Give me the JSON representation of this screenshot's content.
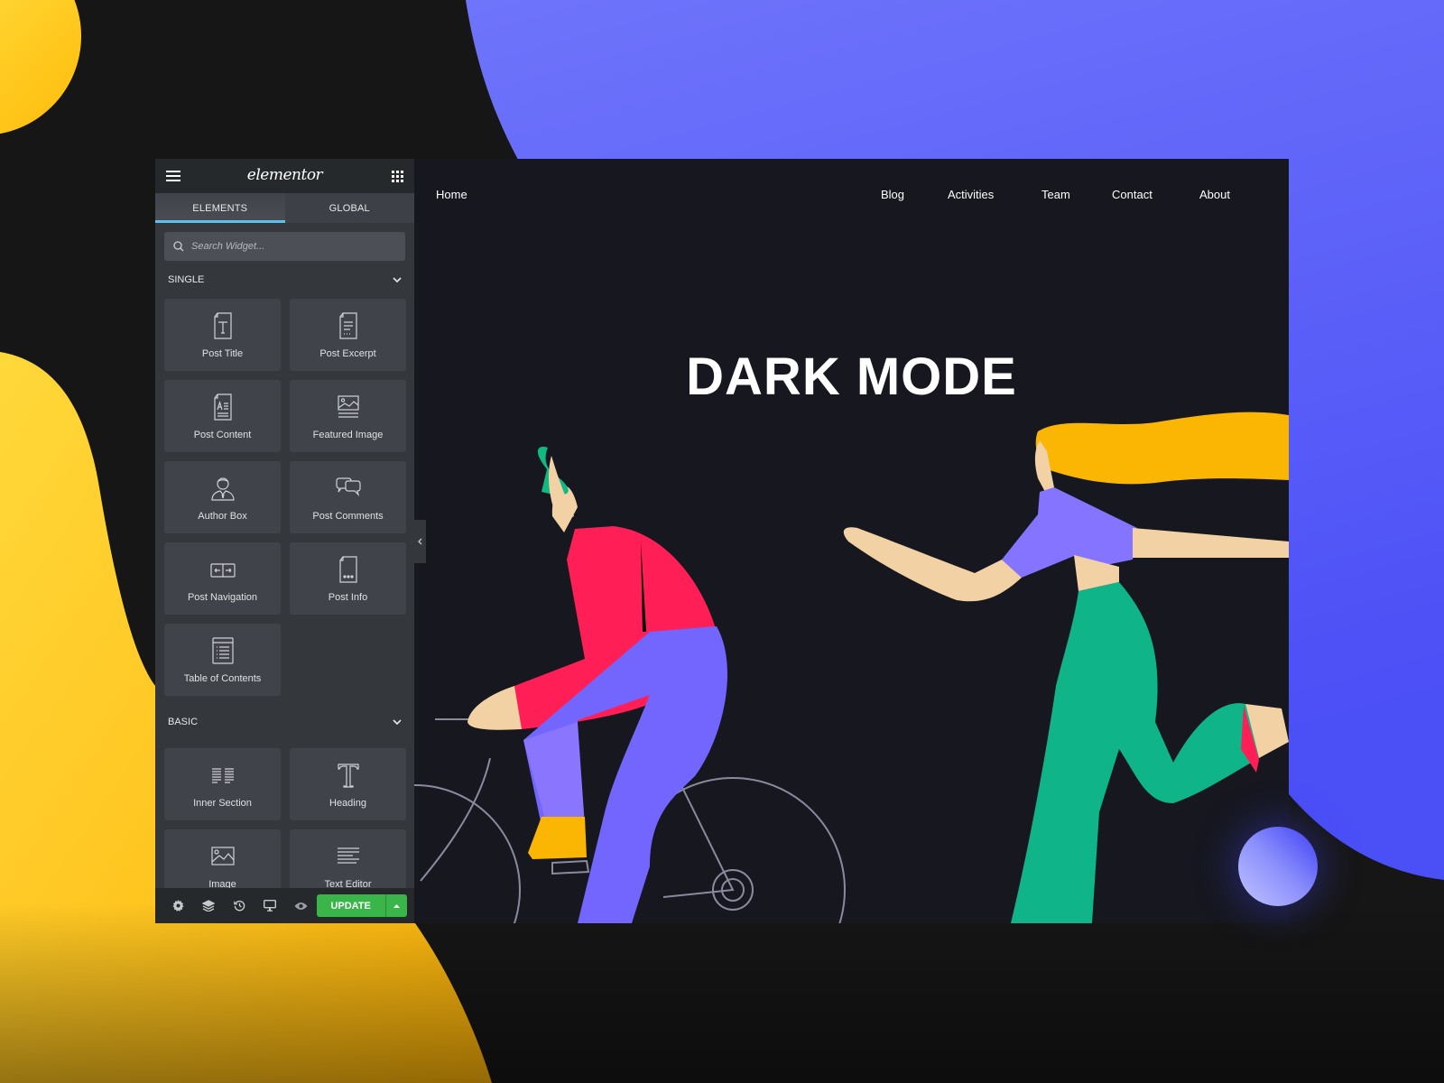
{
  "colors": {
    "background": "#161616",
    "yellow_blob": "#ffc21a",
    "blue_blob": "#5c5ff7",
    "panel": "#34373c",
    "panel_header": "#26292c",
    "tile": "#404349",
    "tab_indicator": "#5bc0eb",
    "update_green": "#39b54a",
    "preview_bg": "#16171f"
  },
  "editor": {
    "logo": "elementor",
    "menu_icon": "hamburger-icon",
    "apps_icon": "grid-icon",
    "tabs": [
      {
        "label": "ELEMENTS",
        "active": true
      },
      {
        "label": "GLOBAL",
        "active": false
      }
    ],
    "search": {
      "placeholder": "Search Widget...",
      "value": ""
    },
    "sections": [
      {
        "title": "SINGLE",
        "widgets": [
          {
            "label": "Post Title",
            "icon": "post-title-icon"
          },
          {
            "label": "Post Excerpt",
            "icon": "post-excerpt-icon"
          },
          {
            "label": "Post Content",
            "icon": "post-content-icon"
          },
          {
            "label": "Featured Image",
            "icon": "featured-image-icon"
          },
          {
            "label": "Author Box",
            "icon": "author-box-icon"
          },
          {
            "label": "Post Comments",
            "icon": "post-comments-icon"
          },
          {
            "label": "Post Navigation",
            "icon": "post-navigation-icon"
          },
          {
            "label": "Post Info",
            "icon": "post-info-icon"
          },
          {
            "label": "Table of Contents",
            "icon": "table-of-contents-icon"
          }
        ]
      },
      {
        "title": "BASIC",
        "widgets": [
          {
            "label": "Inner Section",
            "icon": "inner-section-icon"
          },
          {
            "label": "Heading",
            "icon": "heading-icon"
          },
          {
            "label": "Image",
            "icon": "image-icon"
          },
          {
            "label": "Text Editor",
            "icon": "text-editor-icon"
          }
        ]
      }
    ],
    "footer": {
      "icons": [
        "settings-icon",
        "layers-icon",
        "history-icon",
        "responsive-icon",
        "preview-icon"
      ],
      "update_label": "UPDATE"
    }
  },
  "preview": {
    "nav": {
      "home": "Home",
      "items": [
        "Blog",
        "Activities",
        "Team",
        "Contact",
        "About"
      ]
    },
    "hero_title": "DARK MODE"
  }
}
